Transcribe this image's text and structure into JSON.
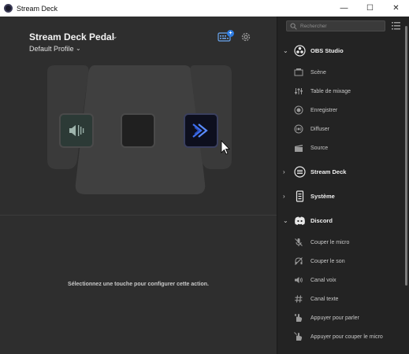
{
  "window": {
    "title": "Stream Deck",
    "controls": {
      "minimize": "—",
      "maximize": "☐",
      "close": "✕"
    }
  },
  "header": {
    "device_name": "Stream Deck Pedal",
    "profile_name": "Default Profile",
    "store_badge": "+"
  },
  "hint_text": "Sélectionnez une touche pour configurer cette action.",
  "search": {
    "placeholder": "Rechercher",
    "value": ""
  },
  "categories": {
    "obs": {
      "label": "OBS Studio",
      "expanded": true,
      "actions": [
        "Scène",
        "Table de mixage",
        "Enregistrer",
        "Diffuser",
        "Source"
      ]
    },
    "streamdeck": {
      "label": "Stream Deck",
      "expanded": false
    },
    "system": {
      "label": "Système",
      "expanded": false
    },
    "discord": {
      "label": "Discord",
      "expanded": true,
      "actions": [
        "Couper le micro",
        "Couper le son",
        "Canal voix",
        "Canal texte",
        "Appuyer pour parler",
        "Appuyer pour couper le micro"
      ]
    }
  },
  "icons": {
    "key1": "speaker-mute-icon",
    "key3": "double-chevron-forward-icon",
    "settings": "gear-icon",
    "store": "keyboard-store-icon"
  },
  "colors": {
    "accent": "#2d7be0",
    "key1_bg": "#2c3a36",
    "key3_bg": "#0d0f1e"
  }
}
